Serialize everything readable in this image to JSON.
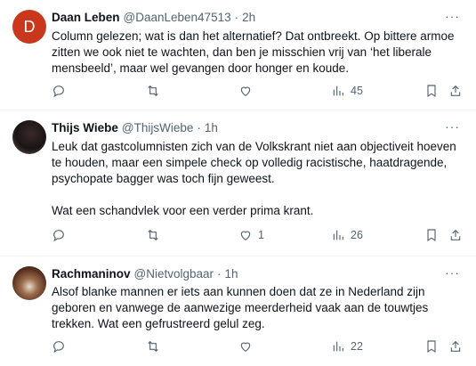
{
  "tweets": [
    {
      "avatar_letter": "D",
      "name": "Daan Leben",
      "handle": "@DaanLeben47513",
      "dot": "·",
      "time": "2h",
      "more": "···",
      "text": [
        "Column gelezen; wat is dan het alternatief? Dat ontbreekt. Op bittere armoe zitten we ook niet te wachten, dan ben je misschien vrij van ‘het liberale mensbeeld’, maar wel gevangen door honger en koude."
      ],
      "likes": "",
      "views": "45"
    },
    {
      "name": "Thijs Wiebe",
      "handle": "@ThijsWiebe",
      "dot": "·",
      "time": "1h",
      "more": "···",
      "text": [
        "Leuk dat gastcolumnisten zich van de Volkskrant niet aan objectiveit hoeven te houden, maar een simpele check op volledig racistische, haatdragende, psychopate bagger was toch fijn geweest.",
        "Wat een schandvlek voor een verder prima krant."
      ],
      "likes": "1",
      "views": "26"
    },
    {
      "name": "Rachmaninov",
      "handle": "@Nietvolgbaar",
      "dot": "·",
      "time": "1h",
      "more": "···",
      "text": [
        "Alsof blanke mannen er iets aan kunnen doen dat ze in Nederland zijn geboren en vanwege de aanwezige meerderheid vaak aan de touwtjes trekken. Wat een gefrustreerd gelul zeg."
      ],
      "likes": "",
      "views": "22"
    }
  ]
}
